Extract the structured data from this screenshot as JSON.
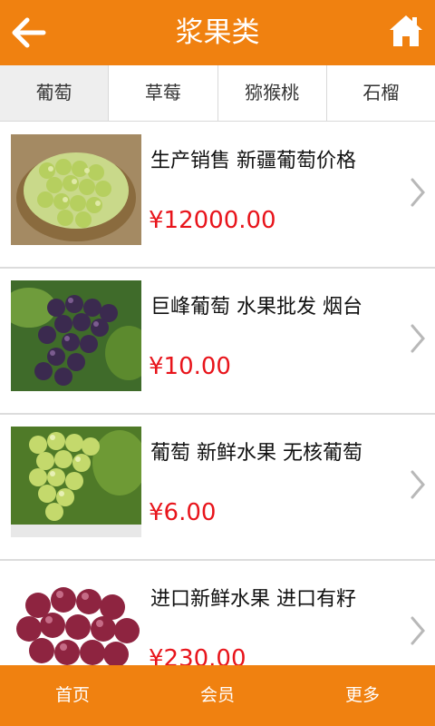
{
  "header": {
    "title": "浆果类",
    "back_icon": "arrow-left-icon",
    "home_icon": "home-icon"
  },
  "tabs": [
    {
      "label": "葡萄",
      "active": true
    },
    {
      "label": "草莓",
      "active": false
    },
    {
      "label": "猕猴桃",
      "active": false
    },
    {
      "label": "石榴",
      "active": false
    }
  ],
  "products": [
    {
      "title": "生产销售 新疆葡萄价格",
      "price": "¥12000.00",
      "image": "green-grapes-basket"
    },
    {
      "title": "巨峰葡萄 水果批发 烟台",
      "price": "¥10.00",
      "image": "purple-grapes-vine"
    },
    {
      "title": "葡萄 新鲜水果 无核葡萄",
      "price": "¥6.00",
      "image": "green-grapes-bunch"
    },
    {
      "title": "进口新鲜水果 进口有籽",
      "price": "¥230.00",
      "image": "red-grapes"
    }
  ],
  "footer": [
    {
      "label": "首页"
    },
    {
      "label": "会员"
    },
    {
      "label": "更多"
    }
  ],
  "colors": {
    "accent": "#f08110",
    "price": "#e8141b"
  }
}
